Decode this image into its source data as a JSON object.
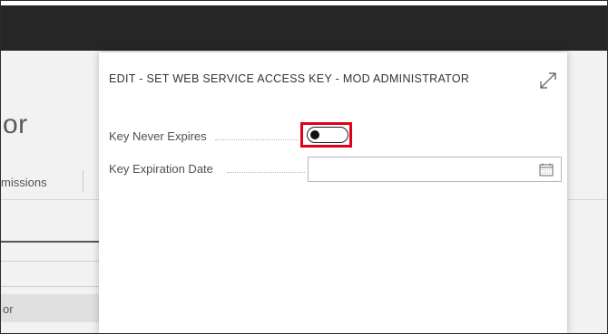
{
  "background": {
    "title_fragment": "or",
    "tab_fragment": "missions",
    "row_fragment": "or"
  },
  "dialog": {
    "title": "EDIT - SET WEB SERVICE ACCESS KEY - MOD ADMINISTRATOR",
    "expand_icon": "expand-icon",
    "fields": {
      "never_expires": {
        "label": "Key Never Expires",
        "value": false
      },
      "expiration_date": {
        "label": "Key Expiration Date",
        "value": "",
        "icon": "calendar-icon"
      }
    }
  },
  "colors": {
    "topbar": "#262626",
    "highlight": "#e0001b"
  }
}
